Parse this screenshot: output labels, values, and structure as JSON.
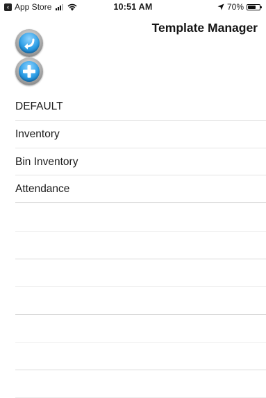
{
  "status_bar": {
    "back_app": "App Store",
    "time": "10:51 AM",
    "battery_text": "70%",
    "battery_level": 0.7
  },
  "header": {
    "title": "Template Manager"
  },
  "icons": {
    "back": "back-arrow-icon",
    "add": "plus-icon",
    "accent": "#2d9ee6"
  },
  "templates": [
    {
      "label": "DEFAULT"
    },
    {
      "label": "Inventory"
    },
    {
      "label": "Bin Inventory"
    },
    {
      "label": "Attendance"
    }
  ]
}
